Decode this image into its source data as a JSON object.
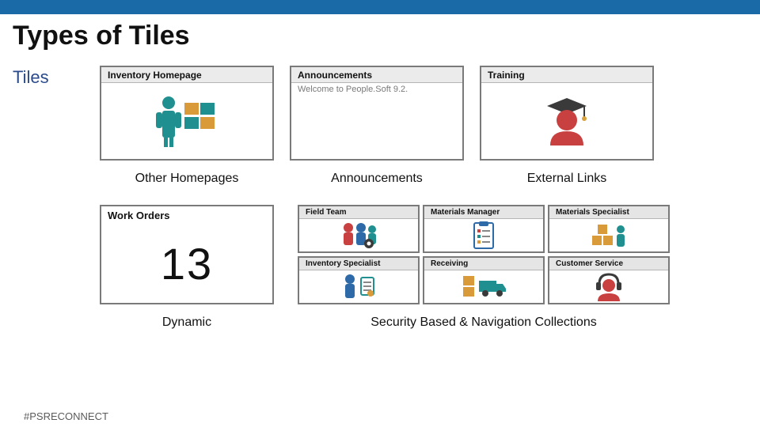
{
  "colors": {
    "topbar": "#196aa6",
    "tileBorder": "#7a7a7a",
    "accentTeal": "#1f8f8f",
    "accentOrange": "#d99a3a",
    "accentRed": "#c94040",
    "accentBlue": "#2f6aa8"
  },
  "slideTitle": "Types of Tiles",
  "rowLabel": "Tiles",
  "footer": "#PSRECONNECT",
  "row1": {
    "tiles": [
      {
        "title": "Inventory Homepage",
        "icon": "inventory-person-boxes"
      },
      {
        "title": "Announcements",
        "subtext": "Welcome to People.Soft 9.2.",
        "icon": "none"
      },
      {
        "title": "Training",
        "icon": "graduate"
      }
    ],
    "captions": [
      "Other Homepages",
      "Announcements",
      "External Links"
    ]
  },
  "row2": {
    "dynamicTile": {
      "title": "Work Orders",
      "value": "13"
    },
    "grid": [
      {
        "title": "Field Team",
        "icon": "people-gear"
      },
      {
        "title": "Materials Manager",
        "icon": "clipboard-list"
      },
      {
        "title": "Materials Specialist",
        "icon": "boxes-person"
      },
      {
        "title": "Inventory Specialist",
        "icon": "person-clipboard"
      },
      {
        "title": "Receiving",
        "icon": "truck-box"
      },
      {
        "title": "Customer Service",
        "icon": "headset-person"
      }
    ],
    "captions": [
      "Dynamic",
      "Security Based & Navigation Collections"
    ]
  }
}
